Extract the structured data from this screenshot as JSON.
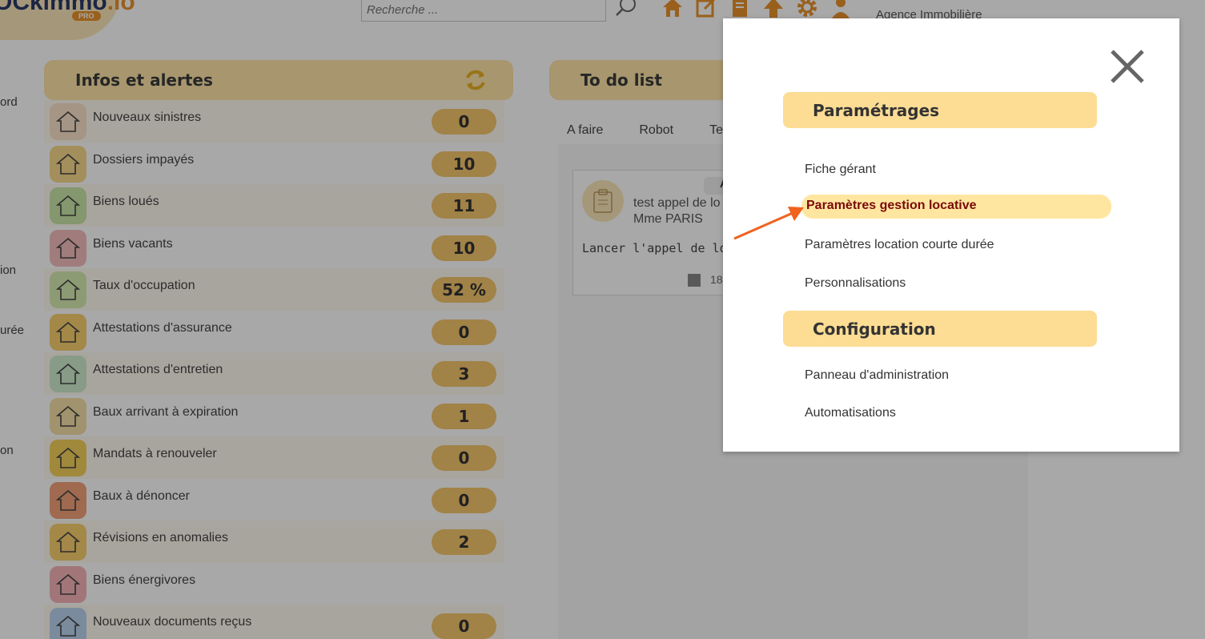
{
  "header": {
    "logo_text": "OCkimmo",
    "logo_suffix": ".io",
    "logo_badge": "PRO",
    "search_placeholder": "Recherche ...",
    "agency_label": "Agence Immobilière"
  },
  "left_nav": {
    "items": [
      "ord",
      "ion",
      "urée",
      "on"
    ]
  },
  "infos_panel": {
    "title": "Infos et alertes",
    "rows": [
      {
        "label": "Nouveaux sinistres",
        "count": "0",
        "icon": "warning-icon",
        "color": "#fbe3c8"
      },
      {
        "label": "Dossiers impayés",
        "count": "10",
        "icon": "unpaid-icon",
        "color": "#f7d98b"
      },
      {
        "label": "Biens loués",
        "count": "11",
        "icon": "house-people-icon",
        "color": "#c9e6a7"
      },
      {
        "label": "Biens vacants",
        "count": "10",
        "icon": "house-key-icon",
        "color": "#f4bcbc"
      },
      {
        "label": "Taux d'occupation",
        "count": "52 %",
        "icon": "occupancy-icon",
        "color": "#d6ebb0"
      },
      {
        "label": "Attestations d'assurance",
        "count": "0",
        "icon": "house-shield-icon",
        "color": "#f7cf6e"
      },
      {
        "label": "Attestations d'entretien",
        "count": "3",
        "icon": "house-search-icon",
        "color": "#cdeccd"
      },
      {
        "label": "Baux arrivant à expiration",
        "count": "1",
        "icon": "building-icon",
        "color": "#f3e0a6"
      },
      {
        "label": "Mandats à renouveler",
        "count": "0",
        "icon": "document-renew-icon",
        "color": "#f5d15b"
      },
      {
        "label": "Baux à dénoncer",
        "count": "0",
        "icon": "document-cancel-icon",
        "color": "#f2a27a"
      },
      {
        "label": "Révisions en anomalies",
        "count": "2",
        "icon": "calculator-icon",
        "color": "#f7cf6e"
      },
      {
        "label": "Biens énergivores",
        "count": "",
        "icon": "hat-icon",
        "color": "#f6b3b8"
      },
      {
        "label": "Nouveaux documents reçus",
        "count": "0",
        "icon": "download-icon",
        "color": "#b9d3ef"
      }
    ]
  },
  "todo_panel": {
    "title": "To do list",
    "tabs": [
      "A faire",
      "Robot",
      "Term"
    ],
    "card": {
      "chip": "A",
      "title": "test appel de lo",
      "subtitle": "Mme PARIS",
      "action": "Lancer l'appel de loyer",
      "date": "18"
    }
  },
  "modal": {
    "close_label": "×",
    "sections": [
      {
        "title": "Paramétrages",
        "items": [
          "Fiche gérant",
          "Paramètres gestion locative",
          "Paramètres location courte durée",
          "Personnalisations"
        ],
        "active_index": 1
      },
      {
        "title": "Configuration",
        "items": [
          "Panneau d'administration",
          "Automatisations"
        ]
      }
    ]
  },
  "colors": {
    "accent": "#e8922c",
    "section_bg": "#fddc94",
    "active_bg": "#ffe6a0",
    "active_text": "#7a0a0a",
    "count_bg": "#f5c56d",
    "arrow": "#f0621e"
  }
}
